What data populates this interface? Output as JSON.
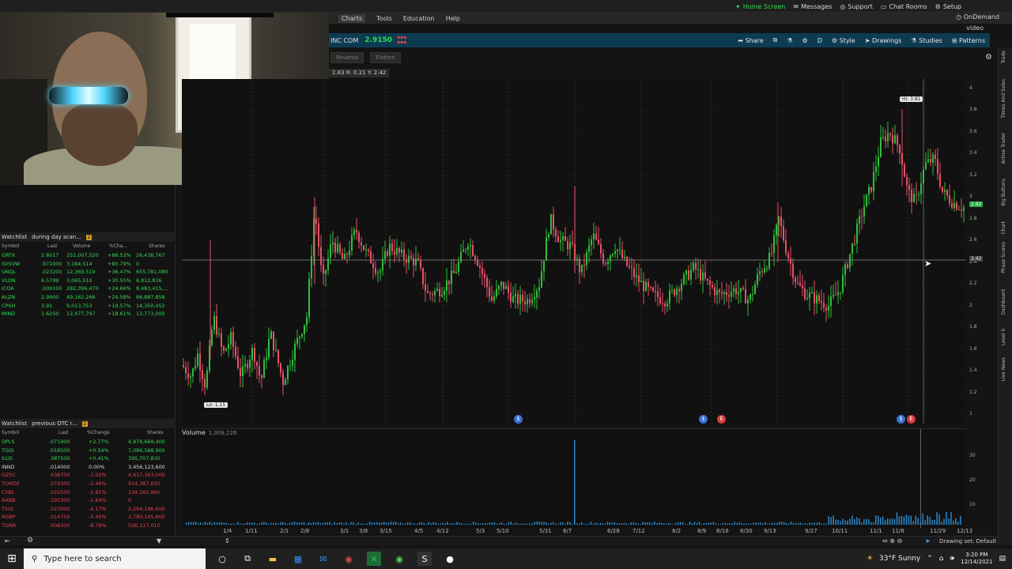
{
  "top_links": [
    "Home Screen",
    "Messages",
    "Support",
    "Chat Rooms",
    "Setup"
  ],
  "menu": [
    "Charts",
    "Tools",
    "Education",
    "Help"
  ],
  "ondemand": "OnDemand",
  "video": "video",
  "quote": {
    "symbol": "INC COM",
    "price": "2.9150"
  },
  "toolbar": [
    "Share",
    "Style",
    "Drawings",
    "Studies",
    "Patterns"
  ],
  "toolbar_period": "D",
  "order_buttons": [
    "Reverse",
    "Flatten"
  ],
  "info_text": "2.83 R: 0.21 Y: 2.42",
  "watchlist1": {
    "title": "Watchlist",
    "name": "during day scan...",
    "badge": "2",
    "columns": [
      "Symbol",
      "Last",
      "Volume",
      "%Cha...",
      "Shares"
    ],
    "rows": [
      {
        "sym": "GRTX",
        "last": "2.6017",
        "vol": "251,007,520",
        "chg": "+88.53%",
        "shares": "26,438,767",
        "color": "#33dd55"
      },
      {
        "sym": "SVSVW",
        "last": ".971000",
        "vol": "3,184,514",
        "chg": "+80.79%",
        "shares": "0",
        "color": "#33dd55"
      },
      {
        "sym": "UNQL",
        "last": ".023200",
        "vol": "12,369,519",
        "chg": "+36.47%",
        "shares": "655,781,080",
        "color": "#33dd55"
      },
      {
        "sym": "VLON",
        "last": "6.5799",
        "vol": "3,065,510",
        "chg": "+30.55%",
        "shares": "6,812,836",
        "color": "#33dd55"
      },
      {
        "sym": "ICOA",
        "last": ".009100",
        "vol": "282,396,470",
        "chg": "+24.66%",
        "shares": "8,483,415,...",
        "color": "#33dd55"
      },
      {
        "sym": "ALZN",
        "last": "2.9900",
        "vol": "49,162,266",
        "chg": "+24.58%",
        "shares": "86,887,858",
        "color": "#33dd55"
      },
      {
        "sym": "CPSH",
        "last": "3.91",
        "vol": "9,013,753",
        "chg": "+19.57%",
        "shares": "14,350,452",
        "color": "#33dd55"
      },
      {
        "sym": "MIND",
        "last": "1.6250",
        "vol": "12,477,797",
        "chg": "+18.61%",
        "shares": "13,773,000",
        "color": "#33dd55"
      }
    ]
  },
  "watchlist2": {
    "title": "Watchlist",
    "name": "previous OTC r...",
    "badge": "2",
    "columns": [
      "Symbol",
      "Last",
      "%Change",
      "Shares"
    ],
    "rows": [
      {
        "sym": "DPLS",
        "last": ".071900",
        "chg": "+2.77%",
        "shares": "4,976,669,400",
        "color": "#33dd55"
      },
      {
        "sym": "TGGI",
        "last": ".018500",
        "chg": "+0.54%",
        "shares": "7,086,588,900",
        "color": "#33dd55"
      },
      {
        "sym": "ILUS",
        "last": ".387500",
        "chg": "+0.41%",
        "shares": "395,707,830",
        "color": "#33dd55"
      },
      {
        "sym": "INND",
        "last": ".014000",
        "chg": "0.00%",
        "shares": "3,456,123,600",
        "color": "#dddddd"
      },
      {
        "sym": "OZSC",
        "last": ".038700",
        "chg": "-3.02%",
        "shares": "4,617,363,000",
        "color": "#e84050"
      },
      {
        "sym": "TOMDF",
        "last": ".079300",
        "chg": "-2.46%",
        "shares": "914,387,630",
        "color": "#e84050"
      },
      {
        "sym": "CYBL",
        "last": ".022500",
        "chg": "-2.81%",
        "shares": "134,282,960",
        "color": "#e84050"
      },
      {
        "sym": "AABB",
        "last": ".195300",
        "chg": "-2.84%",
        "shares": "0",
        "color": "#e84050"
      },
      {
        "sym": "TSOI",
        "last": ".023000",
        "chg": "-4.17%",
        "shares": "2,294,196,600",
        "color": "#e84050"
      },
      {
        "sym": "RGBP",
        "last": ".014750",
        "chg": "-5.45%",
        "shares": "3,780,195,800",
        "color": "#e84050"
      },
      {
        "sym": "TONR",
        "last": ".008300",
        "chg": "-8.79%",
        "shares": "506,117,010",
        "color": "#e84050"
      }
    ]
  },
  "chart_data": {
    "type": "candlestick",
    "hi_label": "Hi: 3.81",
    "lo_label": "Lo: 1.15",
    "current_price": "2.92",
    "crosshair_price": "2.42",
    "price_ticks": [
      "4",
      "3.8",
      "3.6",
      "3.4",
      "3.2",
      "3",
      "2.8",
      "2.6",
      "2.4",
      "2.2",
      "2",
      "1.8",
      "1.6",
      "1.4",
      "1.2",
      "1"
    ],
    "date_ticks": [
      "1/4",
      "1/11",
      "2/1",
      "2/8",
      "3/1",
      "3/8",
      "3/15",
      "4/5",
      "4/12",
      "5/3",
      "5/10",
      "5/31",
      "6/7",
      "6/28",
      "7/12",
      "8/2",
      "8/9",
      "8/16",
      "8/30",
      "9/13",
      "9/27",
      "10/11",
      "11/1",
      "11/8",
      "11/29",
      "12/13"
    ],
    "volume_label": "Volume",
    "volume_value": "1,009,226",
    "volume_ticks": [
      "30",
      "20",
      "10"
    ]
  },
  "drawing_set": "Drawing set: Default",
  "taskbar": {
    "search_placeholder": "Type here to search",
    "weather": "33°F Sunny",
    "time": "3:20 PM",
    "date": "12/14/2021"
  },
  "right_tabs": [
    "Trade",
    "Times And Sales",
    "Active Trader",
    "Big Buttons",
    "Chart",
    "Phase Scores",
    "Dashboard",
    "Level II",
    "Live News"
  ]
}
